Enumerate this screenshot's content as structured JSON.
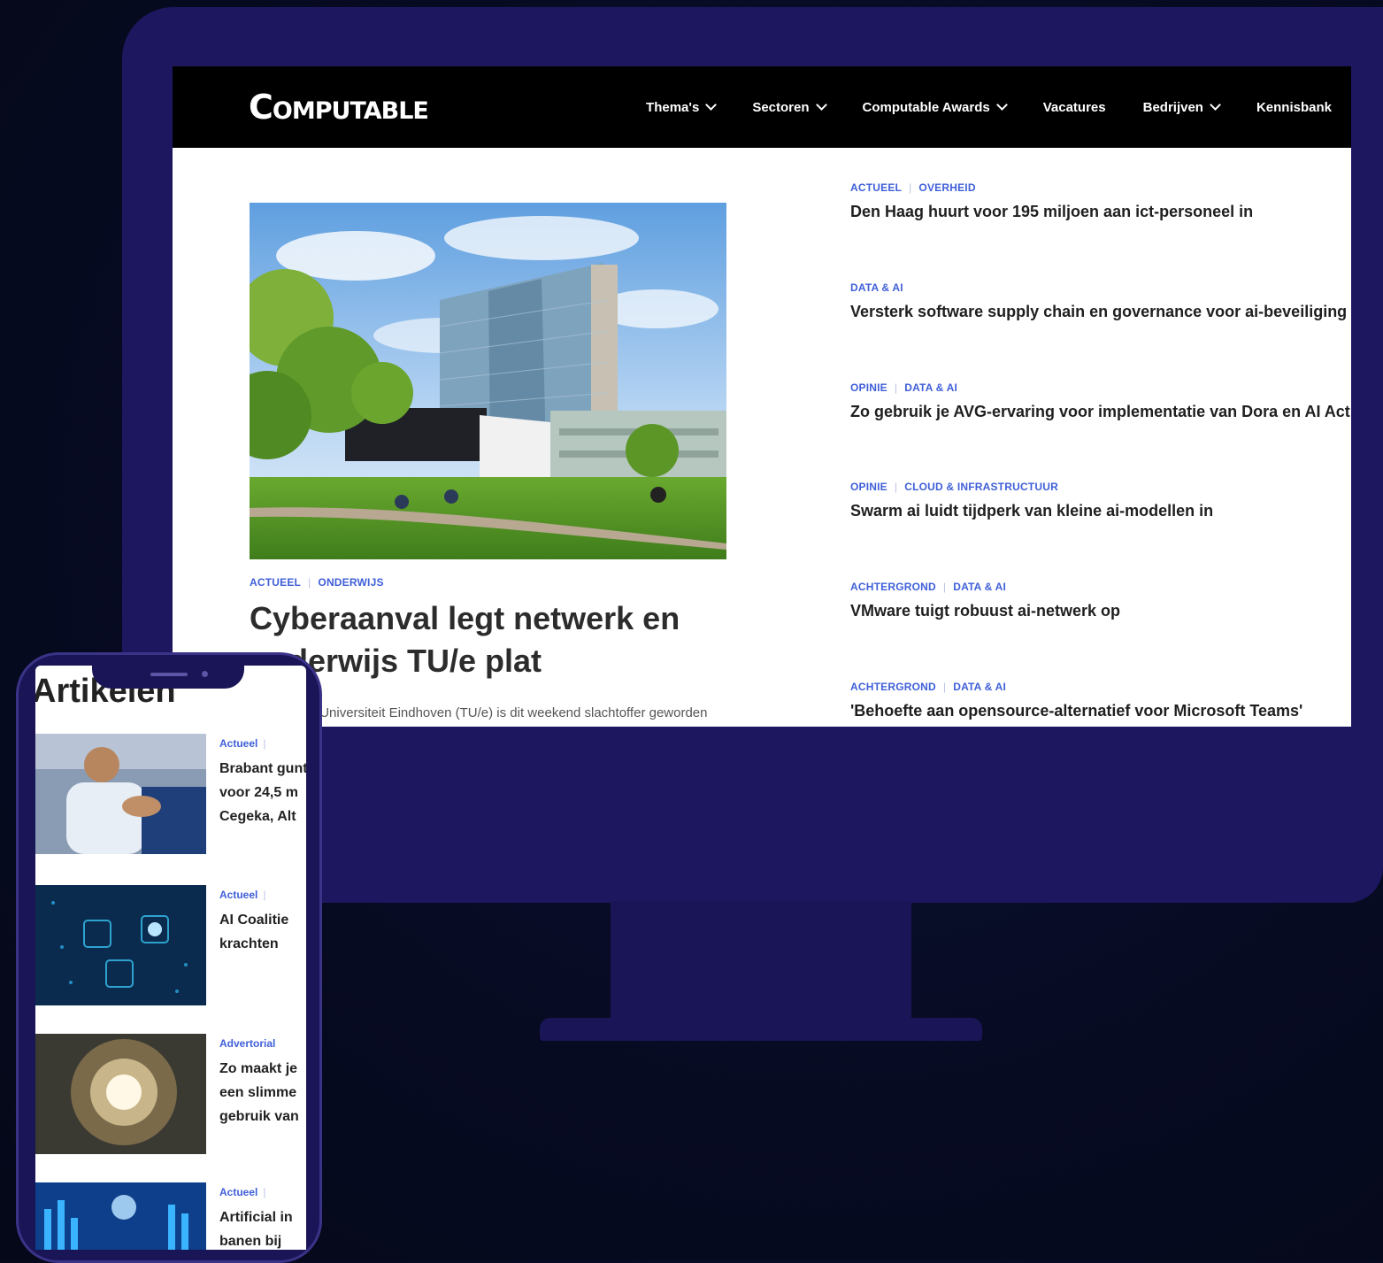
{
  "site": {
    "logo": "Computable",
    "nav": [
      {
        "label": "Thema's",
        "dropdown": true
      },
      {
        "label": "Sectoren",
        "dropdown": true
      },
      {
        "label": "Computable Awards",
        "dropdown": true
      },
      {
        "label": "Vacatures",
        "dropdown": false
      },
      {
        "label": "Bedrijven",
        "dropdown": true
      },
      {
        "label": "Kennisbank",
        "dropdown": false
      }
    ]
  },
  "hero": {
    "categories": [
      "Actueel",
      "Onderwijs"
    ],
    "title": "Cyberaanval legt netwerk en onderwijs TU/e plat",
    "description": "Technische Universiteit Eindhoven (TU/e) is dit weekend slachtoffer geworden"
  },
  "side_articles": [
    {
      "categories": [
        "Actueel",
        "Overheid"
      ],
      "title": "Den Haag huurt voor 195 miljoen aan ict-personeel in"
    },
    {
      "categories": [
        "Data & AI"
      ],
      "title": "Versterk software supply chain en governance voor ai-beveiliging"
    },
    {
      "categories": [
        "Opinie",
        "Data & AI"
      ],
      "title": "Zo gebruik je AVG-ervaring voor implementatie van Dora en AI Act"
    },
    {
      "categories": [
        "Opinie",
        "Cloud & Infrastructuur"
      ],
      "title": "Swarm ai luidt tijdperk van kleine ai-modellen in"
    },
    {
      "categories": [
        "Achtergrond",
        "Data & AI"
      ],
      "title": "VMware tuigt robuust ai-netwerk op"
    },
    {
      "categories": [
        "Achtergrond",
        "Data & AI"
      ],
      "title": "'Behoefte aan opensource-alternatief voor Microsoft Teams'"
    }
  ],
  "mobile": {
    "heading": "Artikelen",
    "cards": [
      {
        "category": "Actueel",
        "title": "Brabant gunt voor 24,5 m Cegeka, Alt"
      },
      {
        "category": "Actueel",
        "title": "AI Coalitie krachten"
      },
      {
        "category": "Advertorial",
        "title": "Zo maakt je een slimme gebruik van"
      },
      {
        "category": "Actueel",
        "title": "Artificial in banen bij"
      }
    ]
  }
}
